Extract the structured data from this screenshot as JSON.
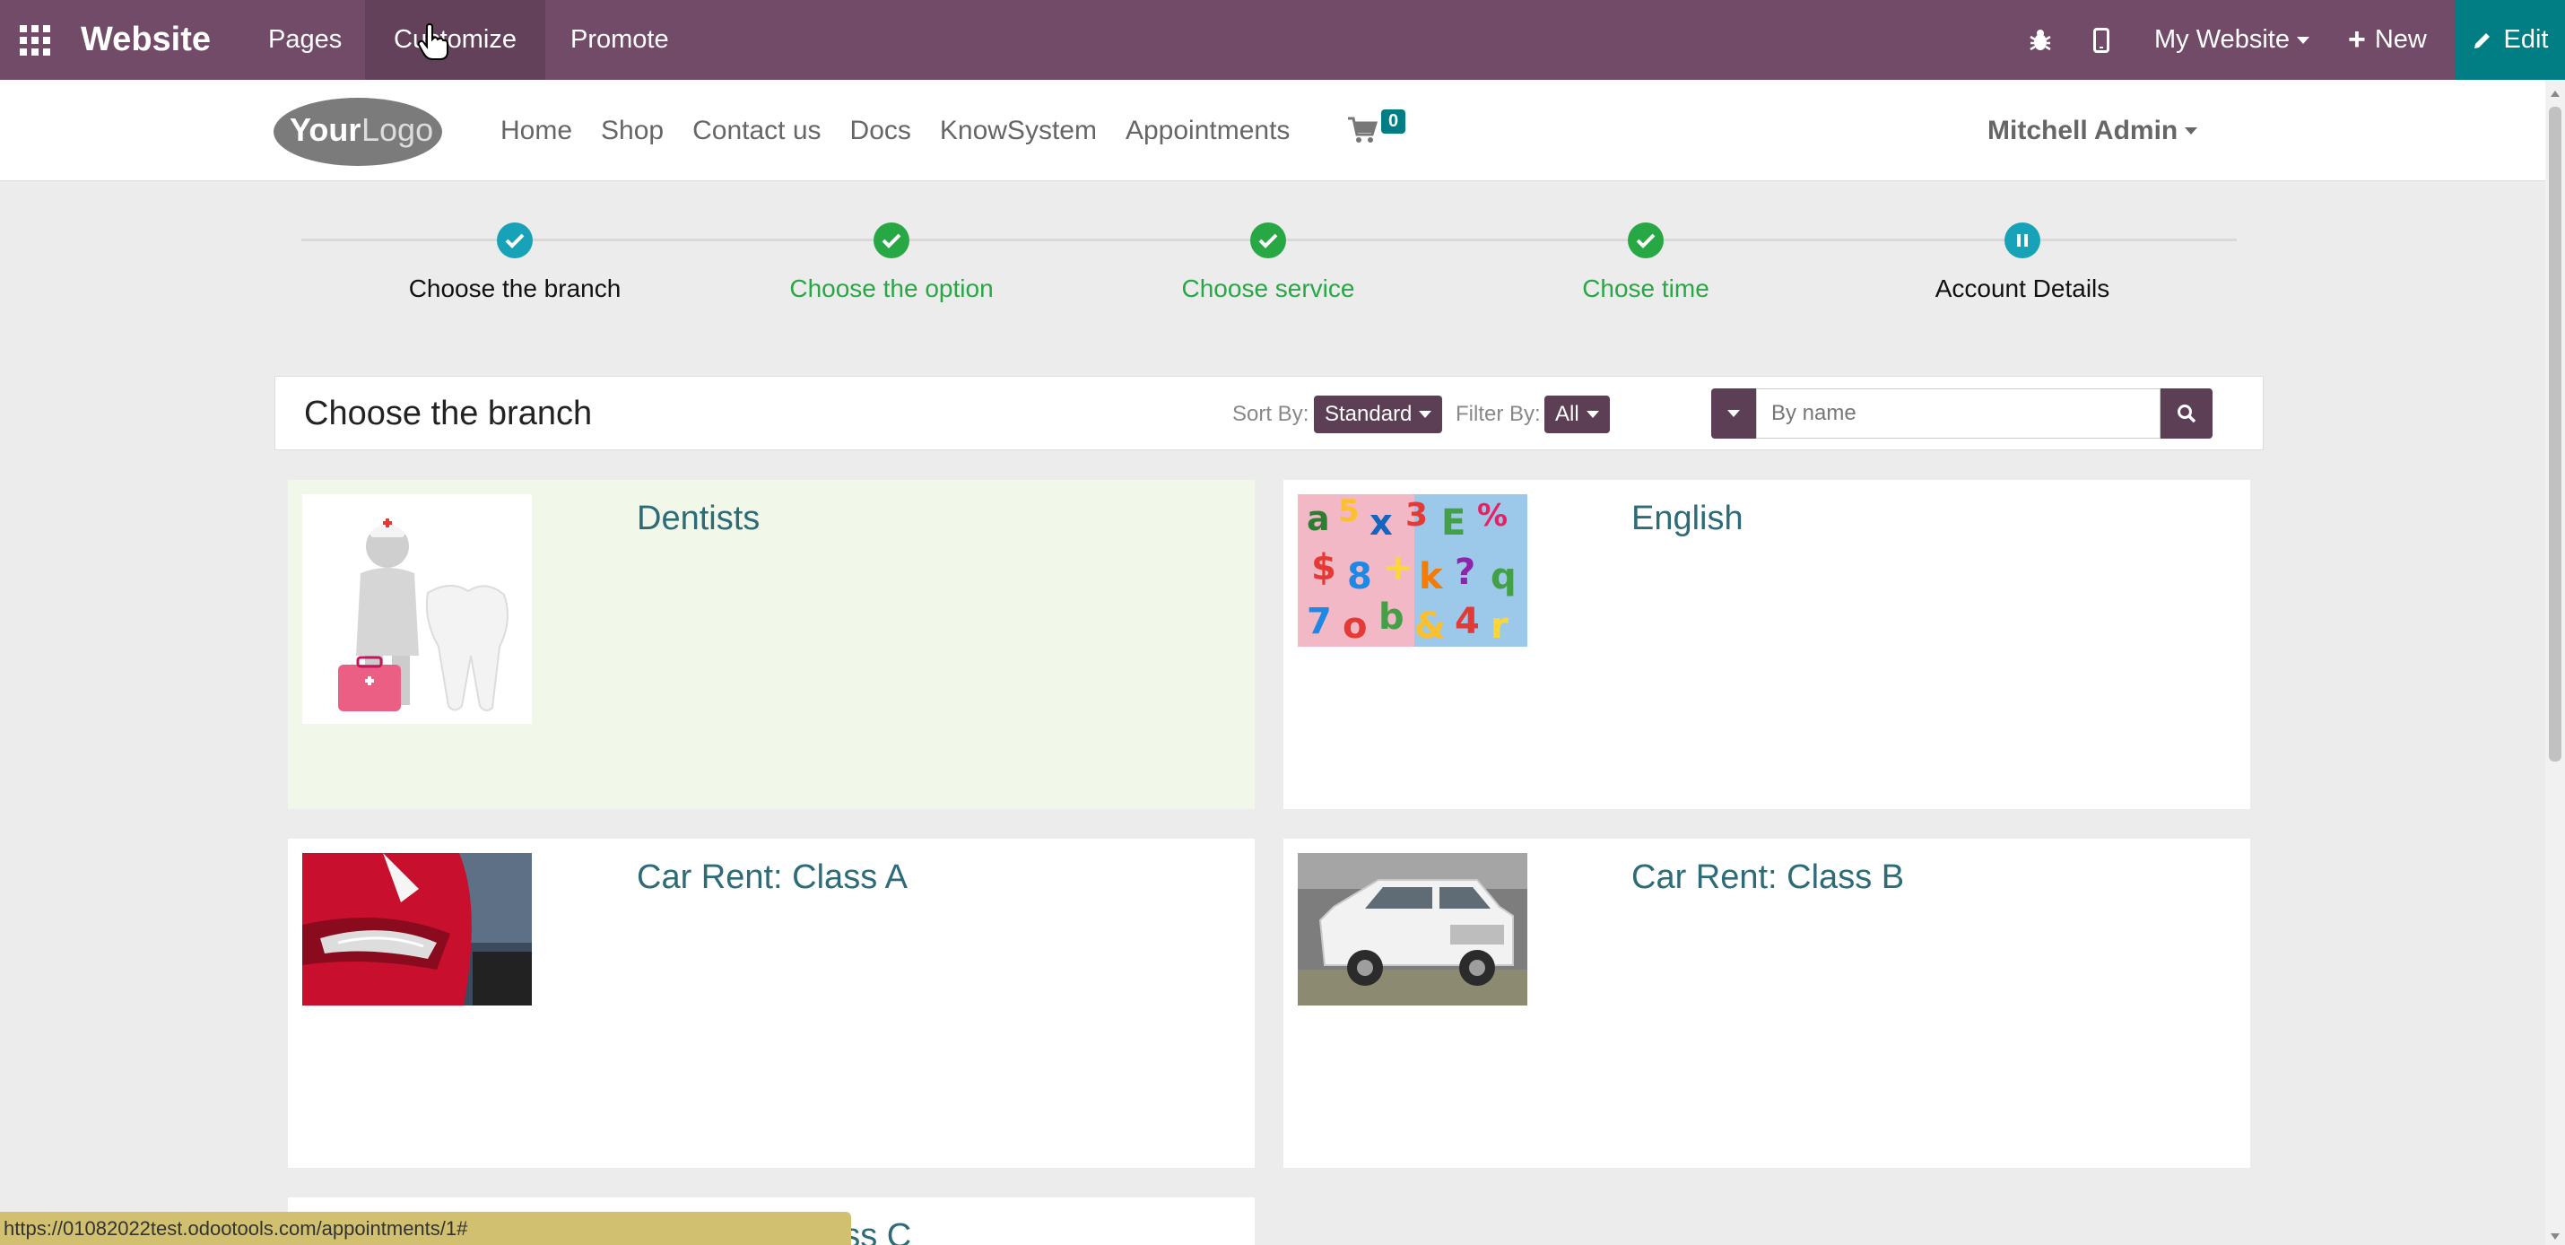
{
  "topbar": {
    "brand": "Website",
    "menu": [
      {
        "label": "Pages"
      },
      {
        "label": "Customize"
      },
      {
        "label": "Promote"
      }
    ],
    "website_selector": "My Website",
    "new_label": "New",
    "edit_label": "Edit",
    "bg_color": "#714b67",
    "edit_color": "#017e84"
  },
  "site_header": {
    "logo_text_1": "Your",
    "logo_text_2": "Logo",
    "nav": [
      {
        "label": "Home"
      },
      {
        "label": "Shop"
      },
      {
        "label": "Contact us"
      },
      {
        "label": "Docs"
      },
      {
        "label": "KnowSystem"
      },
      {
        "label": "Appointments"
      }
    ],
    "cart_count": "0",
    "user": "Mitchell Admin"
  },
  "wizard": {
    "steps": [
      {
        "label": "Choose the branch",
        "state": "done"
      },
      {
        "label": "Choose the option",
        "state": "done"
      },
      {
        "label": "Choose service",
        "state": "done"
      },
      {
        "label": "Chose time",
        "state": "done"
      },
      {
        "label": "Account Details",
        "state": "current"
      }
    ]
  },
  "branch_bar": {
    "title": "Choose the branch",
    "sort_label": "Sort By:",
    "sort_value": "Standard",
    "filter_label": "Filter By:",
    "filter_value": "All",
    "search_placeholder": "By name"
  },
  "cards": [
    {
      "name": "Dentists",
      "image": "dentist-illustration",
      "highlighted": true
    },
    {
      "name": "English",
      "image": "colorful-letters-photo",
      "highlighted": false
    },
    {
      "name": "Car Rent: Class A",
      "image": "red-car-headlight-photo",
      "highlighted": false
    },
    {
      "name": "Car Rent: Class B",
      "image": "white-jeep-photo",
      "highlighted": false
    },
    {
      "name": "Car Rent: Class C",
      "image": "car-photo",
      "highlighted": false
    }
  ],
  "status_url": "https://01082022test.odootools.com/appointments/1#"
}
